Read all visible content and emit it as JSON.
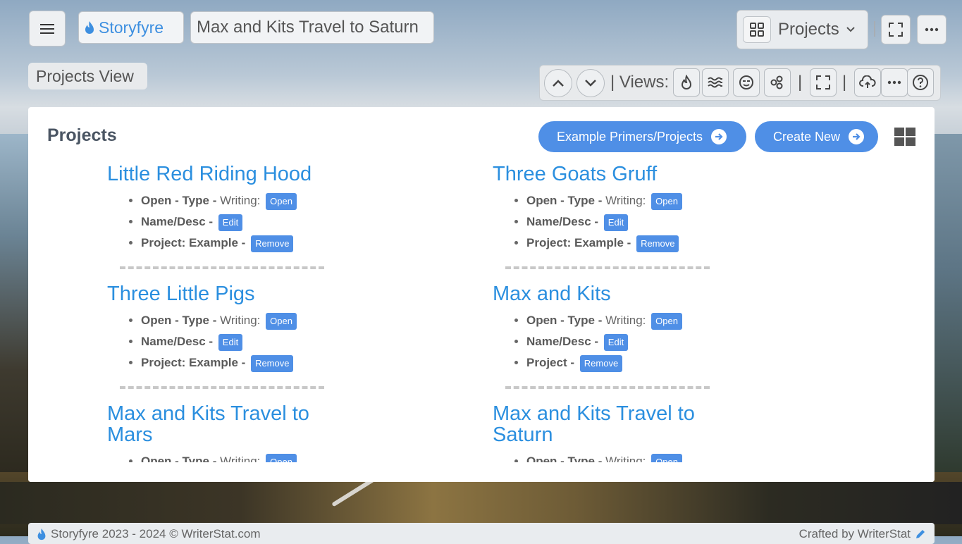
{
  "app": {
    "brand": "Storyfyre",
    "current_project": "Max and Kits Travel to Saturn"
  },
  "header": {
    "view_dropdown": "Projects",
    "view_label": "Projects View"
  },
  "toolbar": {
    "views_label": "| Views:",
    "sep1": "|",
    "sep2": "|"
  },
  "panel": {
    "title": "Projects",
    "example_button": "Example Primers/Projects",
    "create_button": "Create New"
  },
  "projects": [
    {
      "title": "Little Red Riding Hood",
      "open_label": "Open - Type -",
      "type": "Writing:",
      "open_btn": "Open",
      "name_label": "Name/Desc -",
      "edit_btn": "Edit",
      "project_label": "Project: Example -",
      "remove_btn": "Remove"
    },
    {
      "title": "Three Goats Gruff",
      "open_label": "Open - Type -",
      "type": "Writing:",
      "open_btn": "Open",
      "name_label": "Name/Desc -",
      "edit_btn": "Edit",
      "project_label": "Project: Example -",
      "remove_btn": "Remove"
    },
    {
      "title": "Three Little Pigs",
      "open_label": "Open - Type -",
      "type": "Writing:",
      "open_btn": "Open",
      "name_label": "Name/Desc -",
      "edit_btn": "Edit",
      "project_label": "Project: Example -",
      "remove_btn": "Remove"
    },
    {
      "title": "Max and Kits",
      "open_label": "Open - Type -",
      "type": "Writing:",
      "open_btn": "Open",
      "name_label": "Name/Desc -",
      "edit_btn": "Edit",
      "project_label": "Project -",
      "remove_btn": "Remove"
    },
    {
      "title": "Max and Kits Travel to Mars",
      "open_label": "Open - Type -",
      "type": "Writing:",
      "open_btn": "Open"
    },
    {
      "title": "Max and Kits Travel to Saturn",
      "open_label": "Open - Type -",
      "type": "Writing:",
      "open_btn": "Open"
    }
  ],
  "footer": {
    "left": "Storyfyre 2023 - 2024 ©  WriterStat.com",
    "right": "Crafted by WriterStat"
  },
  "colors": {
    "accent": "#4f8fe6",
    "link": "#2b8fdf",
    "brand": "#3d8fe0"
  }
}
